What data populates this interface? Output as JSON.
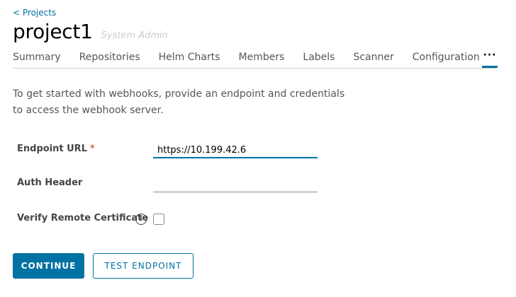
{
  "header": {
    "back_link": "< Projects",
    "title": "project1",
    "role": "System Admin"
  },
  "tabs": [
    {
      "label": "Summary"
    },
    {
      "label": "Repositories"
    },
    {
      "label": "Helm Charts"
    },
    {
      "label": "Members"
    },
    {
      "label": "Labels"
    },
    {
      "label": "Scanner"
    },
    {
      "label": "Configuration"
    },
    {
      "label": "···"
    }
  ],
  "active_tab": "···",
  "intro_text": "To get started with webhooks, provide an endpoint and credentials to access the webhook server.",
  "form": {
    "endpoint_url": {
      "label": "Endpoint URL",
      "required_mark": "*",
      "value": "https://10.199.42.6"
    },
    "auth_header": {
      "label": "Auth Header",
      "value": ""
    },
    "verify_cert": {
      "label": "Verify Remote Certificate",
      "info_icon": "info-icon",
      "checked": false
    }
  },
  "buttons": {
    "continue": "CONTINUE",
    "test_endpoint": "TEST ENDPOINT"
  },
  "colors": {
    "accent": "#0072a3",
    "required": "#c92100"
  }
}
